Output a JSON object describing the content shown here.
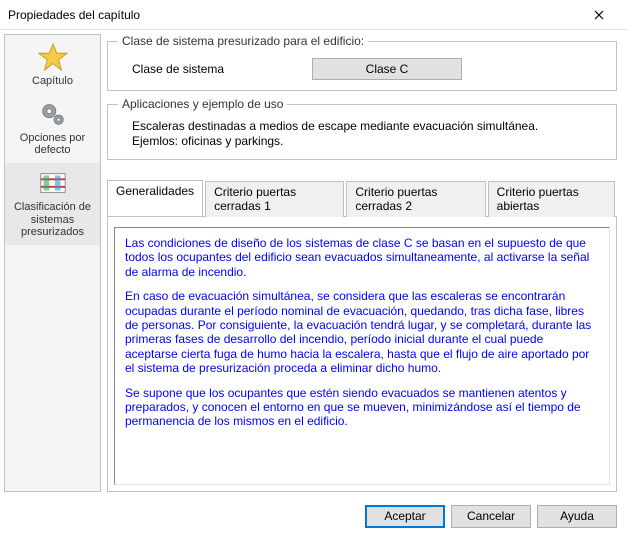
{
  "window": {
    "title": "Propiedades del capítulo"
  },
  "sidebar": {
    "items": [
      {
        "label": "Capítulo"
      },
      {
        "label": "Opciones por defecto"
      },
      {
        "label": "Clasificación de sistemas presurizados"
      }
    ]
  },
  "groups": {
    "class": {
      "legend": "Clase de sistema presurizado para el edificio:",
      "label": "Clase de sistema",
      "button": "Clase C"
    },
    "apps": {
      "legend": "Aplicaciones y ejemplo de uso",
      "line1": "Escaleras destinadas a medios de escape mediante evacuación simultánea.",
      "line2": "Ejemlos: oficinas y parkings."
    }
  },
  "tabs": {
    "items": [
      {
        "label": "Generalidades"
      },
      {
        "label": "Criterio puertas cerradas 1"
      },
      {
        "label": "Criterio puertas cerradas 2"
      },
      {
        "label": "Criterio puertas abiertas"
      }
    ]
  },
  "panel": {
    "p1": "Las condiciones de diseño de los sistemas de clase C se basan en el supuesto de que todos los ocupantes del edificio sean evacuados simultaneamente, al activarse la señal de alarma de incendio.",
    "p2": "En caso de evacuación simultánea, se considera que las escaleras se encontrarán ocupadas durante el período nominal de evacuación, quedando, tras dicha fase, libres de personas. Por consiguiente, la evacuación tendrá lugar, y se completará, durante las primeras fases de desarrollo del incendio, período inicial durante el cual puede aceptarse cierta fuga de humo hacia la escalera, hasta que el flujo de aire aportado por el sistema de presurización proceda a eliminar dicho humo.",
    "p3": "Se supone que los ocupantes que estén siendo evacuados se mantienen atentos y preparados, y conocen el entorno en que se mueven, minimizándose así el tiempo de permanencia de los mismos en el edificio."
  },
  "footer": {
    "accept": "Aceptar",
    "cancel": "Cancelar",
    "help": "Ayuda"
  }
}
